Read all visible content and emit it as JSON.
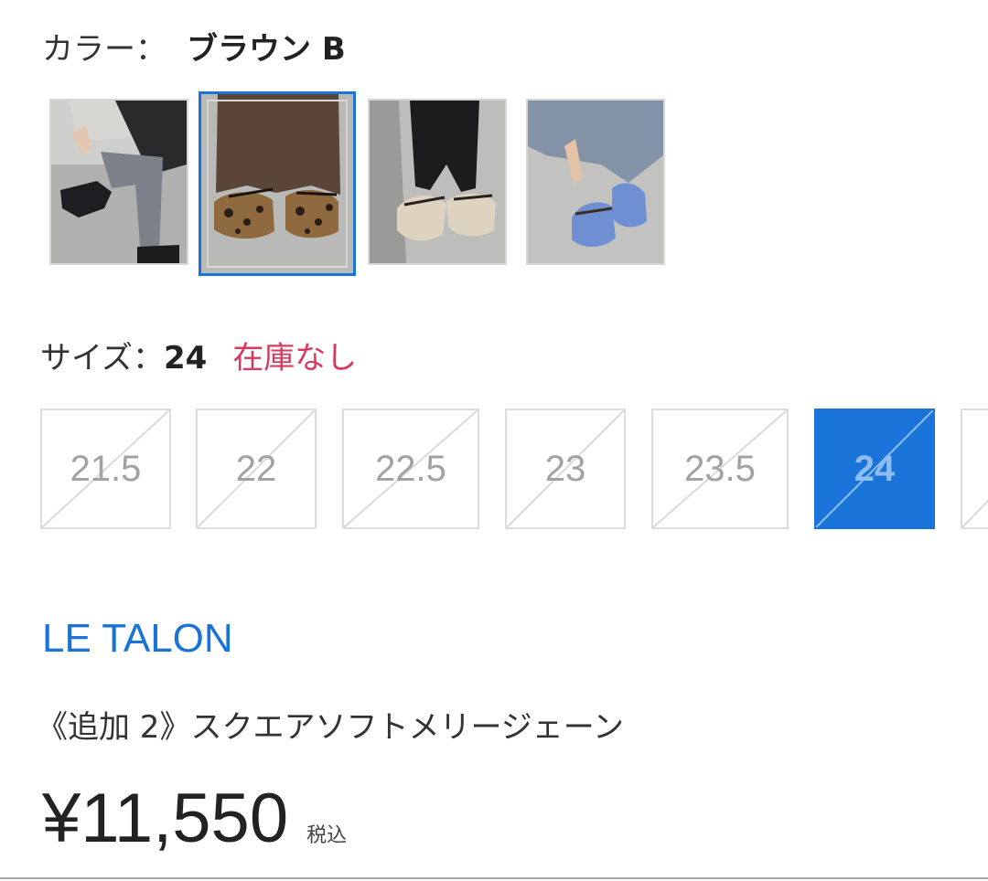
{
  "color": {
    "label": "カラー：",
    "value": "ブラウン B",
    "swatches": [
      {
        "icon": "black-mary-jane-photo",
        "selected": false
      },
      {
        "icon": "leopard-mary-jane-photo",
        "selected": true
      },
      {
        "icon": "beige-raffia-mary-jane-photo",
        "selected": false
      },
      {
        "icon": "blue-mary-jane-photo",
        "selected": false
      }
    ]
  },
  "size": {
    "label": "サイズ：",
    "value": "24",
    "stock_status": "在庫なし",
    "options": [
      {
        "label": "21.5",
        "selected": false,
        "out_of_stock": true
      },
      {
        "label": "22",
        "selected": false,
        "out_of_stock": true
      },
      {
        "label": "22.5",
        "selected": false,
        "out_of_stock": true
      },
      {
        "label": "23",
        "selected": false,
        "out_of_stock": true
      },
      {
        "label": "23.5",
        "selected": false,
        "out_of_stock": true
      },
      {
        "label": "24",
        "selected": true,
        "out_of_stock": true
      },
      {
        "label": "",
        "selected": false,
        "out_of_stock": true
      }
    ]
  },
  "product": {
    "brand": "LE TALON",
    "name": "《追加 2》スクエアソフトメリージェーン",
    "price": "¥11,550",
    "tax_note": "税込"
  },
  "colors": {
    "accent": "#1a73d9",
    "stock_warning": "#d63a5f",
    "text": "#333333",
    "disabled_text": "#a2a2a2"
  }
}
